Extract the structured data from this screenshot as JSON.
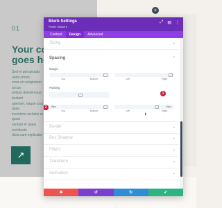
{
  "background": {
    "number": "01",
    "heading": "Your co\ngoes he",
    "body": "Sed et perspiciatis unde omnis\nerror sit voluptatem accus\nantium doloremque laudant\naperiam, eaque ipsa quae\ninventore veritatis et quasi\nveniam et quasi architecto\ndicta sunt explicabo",
    "arrow_icon": "↗",
    "plus_icon": "+"
  },
  "modal": {
    "title": "Blurb Settings",
    "preset": "Preset: Default ▾",
    "controls": [
      "⤢",
      "▤",
      "⋮"
    ],
    "tabs": [
      {
        "label": "Content",
        "active": false
      },
      {
        "label": "Design",
        "active": true
      },
      {
        "label": "Advanced",
        "active": false
      }
    ],
    "sections": {
      "sizing": "Sizing",
      "spacing": "Spacing",
      "border": "Border",
      "box_shadow": "Box Shadow",
      "filters": "Filters",
      "transform": "Transform",
      "animation": "Animation"
    },
    "chevron_collapsed": "⌄",
    "chevron_expanded": "⌃",
    "margin": {
      "label": "Margin",
      "caps": {
        "top": "Top",
        "bottom": "Bottom",
        "left": "Left",
        "right": "Right"
      }
    },
    "padding": {
      "label": "Padding",
      "top_value": "25px",
      "right_value": "10px",
      "caps": {
        "top": "Top",
        "bottom": "Bottom",
        "left": "Left",
        "right": "Right"
      }
    },
    "markers": [
      "1",
      "2"
    ],
    "footer": {
      "cancel": "✖",
      "undo": "↺",
      "redo": "↻",
      "save": "✔"
    },
    "colors": {
      "header": "#6c2eb9",
      "tabs": "#8d3fe4",
      "cancel": "#ef5350",
      "undo": "#7b3fcf",
      "redo": "#2f8ed1",
      "save": "#2cb583",
      "marker": "#c71f36"
    }
  }
}
